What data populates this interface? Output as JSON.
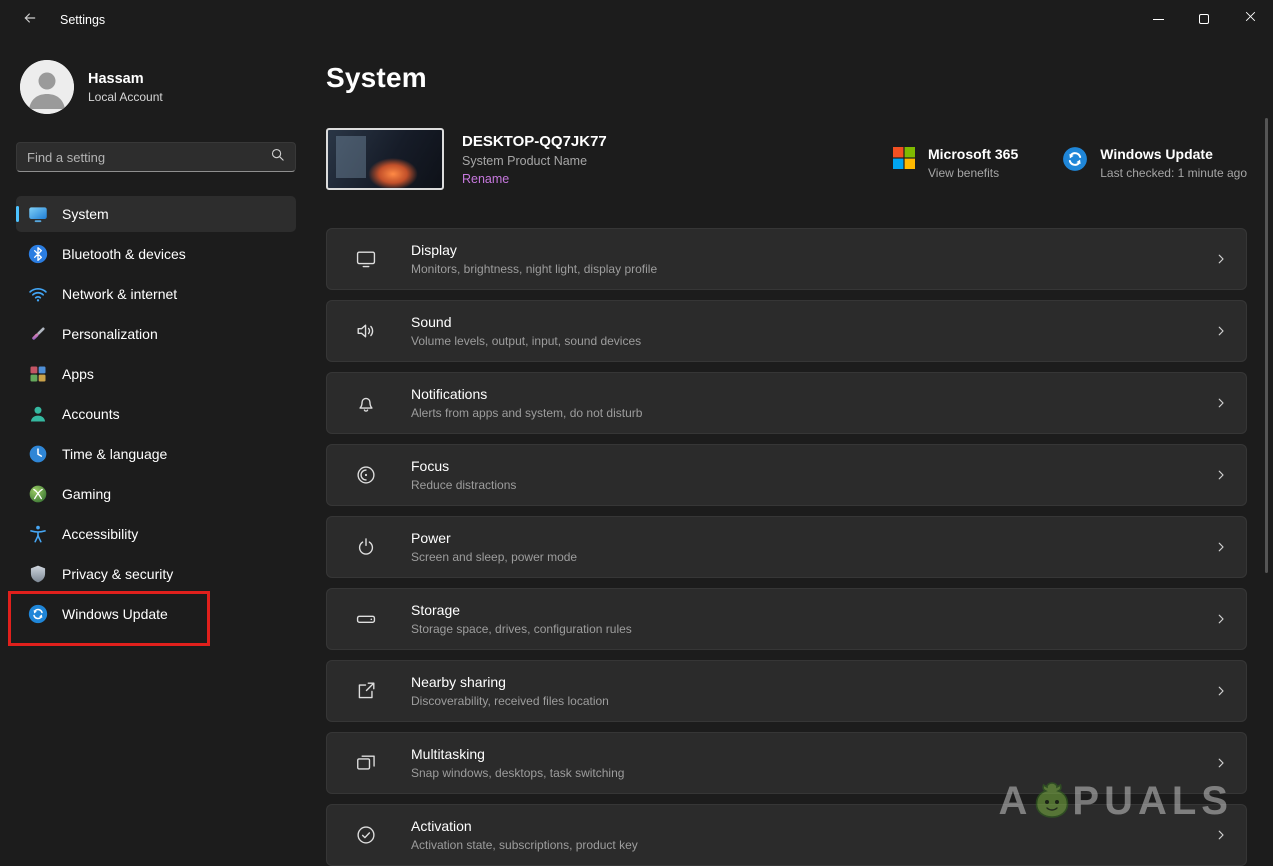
{
  "colors": {
    "accent": "#4cc2ff",
    "annotation_red": "#e0201c",
    "rename_link": "#c678dd",
    "card": "#2b2b2b"
  },
  "titlebar": {
    "title": "Settings"
  },
  "sidebar": {
    "user": {
      "name": "Hassam",
      "subtitle": "Local Account"
    },
    "search": {
      "placeholder": "Find a setting"
    },
    "items": [
      {
        "label": "System",
        "icon": "system-icon",
        "selected": true
      },
      {
        "label": "Bluetooth & devices",
        "icon": "bluetooth-icon"
      },
      {
        "label": "Network & internet",
        "icon": "network-icon"
      },
      {
        "label": "Personalization",
        "icon": "personalization-icon"
      },
      {
        "label": "Apps",
        "icon": "apps-icon"
      },
      {
        "label": "Accounts",
        "icon": "accounts-icon"
      },
      {
        "label": "Time & language",
        "icon": "time-language-icon"
      },
      {
        "label": "Gaming",
        "icon": "gaming-icon"
      },
      {
        "label": "Accessibility",
        "icon": "accessibility-icon"
      },
      {
        "label": "Privacy & security",
        "icon": "privacy-security-icon"
      },
      {
        "label": "Windows Update",
        "icon": "windows-update-icon",
        "highlighted_by_red_annotation": true
      }
    ]
  },
  "main": {
    "title": "System",
    "device": {
      "name": "DESKTOP-QQ7JK77",
      "product_name": "System Product Name",
      "rename_label": "Rename"
    },
    "microsoft365": {
      "title": "Microsoft 365",
      "subtitle": "View benefits"
    },
    "windows_update": {
      "title": "Windows Update",
      "subtitle": "Last checked: 1 minute ago"
    },
    "rows": [
      {
        "title": "Display",
        "subtitle": "Monitors, brightness, night light, display profile",
        "icon": "display-icon"
      },
      {
        "title": "Sound",
        "subtitle": "Volume levels, output, input, sound devices",
        "icon": "sound-icon"
      },
      {
        "title": "Notifications",
        "subtitle": "Alerts from apps and system, do not disturb",
        "icon": "notifications-icon"
      },
      {
        "title": "Focus",
        "subtitle": "Reduce distractions",
        "icon": "focus-icon"
      },
      {
        "title": "Power",
        "subtitle": "Screen and sleep, power mode",
        "icon": "power-icon"
      },
      {
        "title": "Storage",
        "subtitle": "Storage space, drives, configuration rules",
        "icon": "storage-icon"
      },
      {
        "title": "Nearby sharing",
        "subtitle": "Discoverability, received files location",
        "icon": "nearby-sharing-icon"
      },
      {
        "title": "Multitasking",
        "subtitle": "Snap windows, desktops, task switching",
        "icon": "multitasking-icon"
      },
      {
        "title": "Activation",
        "subtitle": "Activation state, subscriptions, product key",
        "icon": "activation-icon"
      }
    ]
  },
  "watermark": {
    "left": "A",
    "right": "PUALS"
  }
}
